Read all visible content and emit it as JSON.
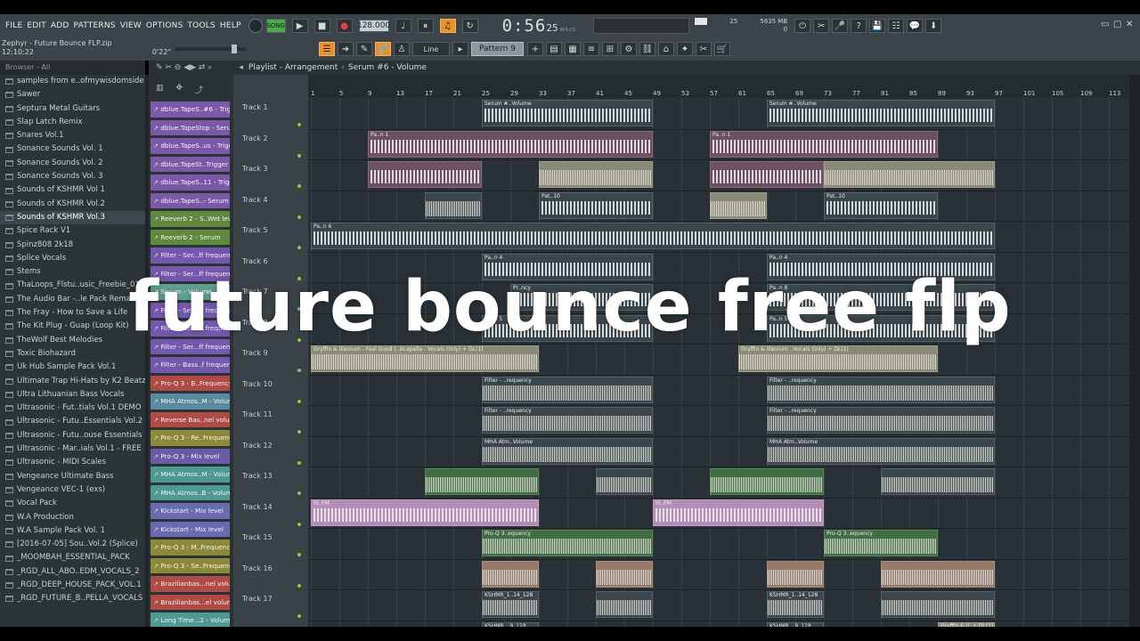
{
  "menu": [
    "FILE",
    "EDIT",
    "ADD",
    "PATTERNS",
    "VIEW",
    "OPTIONS",
    "TOOLS",
    "HELP"
  ],
  "transport": {
    "mode": "SONG",
    "tempo": "128.000",
    "time": "0:56",
    "time_frac": "25",
    "time_unit": "M:S:CS",
    "cpu": "25",
    "memory": "5635 MB",
    "memory_value": "0"
  },
  "project": {
    "file": "Zephyr - Future Bounce FLP.zip",
    "clock": "12:10:22",
    "position": "0'22\""
  },
  "toolbar": {
    "snap": "Line",
    "pattern": "Pattern 9"
  },
  "browser": {
    "header": "Browser - All",
    "selected_index": 10,
    "items": [
      "samples from e..ofmywisdomside",
      "Sawer",
      "Septura Metal Guitars",
      "Slap Latch Remix",
      "Snares Vol.1",
      "Sonance Sounds Vol. 1",
      "Sonance Sounds Vol. 2",
      "Sonance Sounds Vol. 3",
      "Sounds of KSHMR Vol 1",
      "Sounds of KSHMR Vol.2",
      "Sounds of KSHMR Vol.3",
      "Spice Rack V1",
      "Spinz808 2k18",
      "Splice Vocals",
      "Stems",
      "ThaLoops_Flstu..usic_Freebie_01",
      "The Audio Bar -..le Pack Remake)",
      "The Fray - How to Save a Life",
      "The Kit Plug - Guap (Loop Kit)",
      "TheWolf Best Melodies",
      "Toxic Biohazard",
      "Uk Hub Sample Pack Vol.1",
      "Ultimate Trap Hi-Hats by K2 Beatz",
      "Ultra Lithuanian Bass Vocals",
      "Ultrasonic - Fut..tials Vol.1 DEMO",
      "Ultrasonic - Futu..Essentials Vol.2",
      "Ultrasonic - Futu..ouse Essentials",
      "Ultrasonic - Mar..ials Vol.1 - FREE",
      "Ultrasonic - MIDI Scales",
      "Vengeance Ultimate Bass",
      "Vengeance VEC-1 (exs)",
      "Vocal Pack",
      "W.A Production",
      "W.A Sample Pack Vol. 1",
      "[2016-07-05] Sou..Vol.2 (Splice)",
      "_MOOMBAH_ESSENTIAL_PACK",
      "_RGD_ALL_ABO..EDM_VOCALS_2",
      "_RGD_DEEP_HOUSE_PACK_VOL.1",
      "_RGD_FUTURE_B..PELLA_VOCALS"
    ]
  },
  "clips": [
    {
      "label": "dblue.TapeS..#6 - Trigger",
      "color": "#7a5aa8"
    },
    {
      "label": "dblue.TapeStop - Serum",
      "color": "#7a5aa8"
    },
    {
      "label": "dblue.TapeS..us - Trigger",
      "color": "#7a5aa8"
    },
    {
      "label": "dblue.TapeSt..Trigger #2",
      "color": "#7a5aa8"
    },
    {
      "label": "dblue.TapeS..11 - Trigger",
      "color": "#7a5aa8"
    },
    {
      "label": "dblue.TapeS..- Serum #2",
      "color": "#7a5aa8"
    },
    {
      "label": "Reeverb 2 - S..Wet level",
      "color": "#5f8a3e"
    },
    {
      "label": "Reeverb 2 - Serum",
      "color": "#5f8a3e"
    },
    {
      "label": "Filter - Ser...ff frequency",
      "color": "#7458ad"
    },
    {
      "label": "Filter - Ser...ff frequency",
      "color": "#7458ad"
    },
    {
      "label": "Serum - Volume",
      "color": "#5fa090"
    },
    {
      "label": "Filter - Ser...ff frequency",
      "color": "#7458ad"
    },
    {
      "label": "Filter - Ser...ff frequency",
      "color": "#7458ad"
    },
    {
      "label": "Filter - Ser...ff frequency",
      "color": "#7458ad"
    },
    {
      "label": "Filter - Bass..f frequency",
      "color": "#7458ad"
    },
    {
      "label": "Pro-Q 3 - B..Frequency",
      "color": "#b04a44"
    },
    {
      "label": "MHA Atmos..M - Volume",
      "color": "#5a8aa0"
    },
    {
      "label": "Reverse Bas..nel volume",
      "color": "#b04a44"
    },
    {
      "label": "Pro-Q 3 - Re..Frequency",
      "color": "#8a8a3a"
    },
    {
      "label": "Pro-Q 3 - Mix level",
      "color": "#6a5aa8"
    },
    {
      "label": "MHA Atmos..M - Volume",
      "color": "#4f9a90"
    },
    {
      "label": "MHA Atmos..B - Volume",
      "color": "#4f9a90"
    },
    {
      "label": "Kickstart - Mix level",
      "color": "#6a6ab0"
    },
    {
      "label": "Kickstart - Mix level",
      "color": "#6a6ab0"
    },
    {
      "label": "Pro-Q 3 - M..Frequency",
      "color": "#8a8a3a"
    },
    {
      "label": "Pro-Q 3 - Se..Frequency",
      "color": "#8a8a3a"
    },
    {
      "label": "Brazilianbas...nel volume",
      "color": "#b04a44"
    },
    {
      "label": "Brazilianbas...el volume",
      "color": "#b04a44"
    },
    {
      "label": "Long Time...2 - Volume",
      "color": "#4f9a90"
    }
  ],
  "playlist": {
    "title": "Playlist - Arrangement",
    "breadcrumb": "Serum #6 - Volume",
    "ruler": [
      "1",
      "5",
      "9",
      "13",
      "17",
      "21",
      "25",
      "29",
      "33",
      "37",
      "41",
      "45",
      "49",
      "53",
      "57",
      "61",
      "65",
      "69",
      "73",
      "77",
      "81",
      "85",
      "89",
      "93",
      "97",
      "101",
      "105",
      "109",
      "113"
    ],
    "tracks": [
      "Track 1",
      "Track 2",
      "Track 3",
      "Track 4",
      "Track 5",
      "Track 6",
      "Track 7",
      "Track 8",
      "Track 9",
      "Track 10",
      "Track 11",
      "Track 12",
      "Track 13",
      "Track 14",
      "Track 15",
      "Track 16",
      "Track 17",
      "Track 18"
    ],
    "patterns": [
      {
        "track": 0,
        "start": 25,
        "end": 49,
        "label": "Serum #..Volume",
        "color": "c-dark",
        "style": "notes"
      },
      {
        "track": 0,
        "start": 65,
        "end": 97,
        "label": "Serum #..Volume",
        "color": "c-dark",
        "style": "notes"
      },
      {
        "track": 1,
        "start": 9,
        "end": 49,
        "label": "Pa..n 1",
        "color": "c-mauve",
        "style": "notes"
      },
      {
        "track": 1,
        "start": 57,
        "end": 89,
        "label": "Pa..n 1",
        "color": "c-mauve",
        "style": "notes"
      },
      {
        "track": 2,
        "start": 9,
        "end": 25,
        "label": "",
        "color": "c-mauve",
        "style": "notes"
      },
      {
        "track": 2,
        "start": 33,
        "end": 49,
        "label": "",
        "color": "c-tan",
        "style": "wave"
      },
      {
        "track": 2,
        "start": 57,
        "end": 73,
        "label": "",
        "color": "c-mauve",
        "style": "notes"
      },
      {
        "track": 2,
        "start": 73,
        "end": 97,
        "label": "",
        "color": "c-tan",
        "style": "wave"
      },
      {
        "track": 3,
        "start": 17,
        "end": 25,
        "label": "",
        "color": "c-dark",
        "style": "wave"
      },
      {
        "track": 3,
        "start": 33,
        "end": 49,
        "label": "Pat..10",
        "color": "c-dark",
        "style": "notes"
      },
      {
        "track": 3,
        "start": 57,
        "end": 65,
        "label": "",
        "color": "c-tan",
        "style": "wave"
      },
      {
        "track": 3,
        "start": 73,
        "end": 89,
        "label": "Pat..10",
        "color": "c-dark",
        "style": "notes"
      },
      {
        "track": 4,
        "start": 1,
        "end": 97,
        "label": "Pa..n 6",
        "color": "c-dark",
        "style": "notes"
      },
      {
        "track": 5,
        "start": 25,
        "end": 49,
        "label": "Pa..n 4",
        "color": "c-dark",
        "style": "notes"
      },
      {
        "track": 5,
        "start": 65,
        "end": 97,
        "label": "Pa..n 4",
        "color": "c-dark",
        "style": "notes"
      },
      {
        "track": 6,
        "start": 29,
        "end": 49,
        "label": "Pr..ncy",
        "color": "c-dark",
        "style": "notes"
      },
      {
        "track": 6,
        "start": 65,
        "end": 97,
        "label": "Pa..n 8",
        "color": "c-dark",
        "style": "notes"
      },
      {
        "track": 7,
        "start": 25,
        "end": 49,
        "label": "Pa..n 5",
        "color": "c-dark",
        "style": "notes"
      },
      {
        "track": 7,
        "start": 65,
        "end": 97,
        "label": "Pa..n 5",
        "color": "c-dark",
        "style": "notes"
      },
      {
        "track": 8,
        "start": 1,
        "end": 33,
        "label": "Gryffin & Illenium - Feel Good (..Acapella - Vocals Only) + DL(1)",
        "color": "c-tan",
        "style": "wave"
      },
      {
        "track": 8,
        "start": 61,
        "end": 89,
        "label": "Gryffin & Illenium ..Vocals Only) + DL(1)",
        "color": "c-tan",
        "style": "wave"
      },
      {
        "track": 9,
        "start": 25,
        "end": 49,
        "label": "Filter - ..requency",
        "color": "c-dark",
        "style": "wave"
      },
      {
        "track": 9,
        "start": 65,
        "end": 97,
        "label": "Filter - ..requency",
        "color": "c-dark",
        "style": "wave"
      },
      {
        "track": 10,
        "start": 25,
        "end": 49,
        "label": "Filter - ..requency",
        "color": "c-dark",
        "style": "wave"
      },
      {
        "track": 10,
        "start": 65,
        "end": 97,
        "label": "Filter - ..requency",
        "color": "c-dark",
        "style": "wave"
      },
      {
        "track": 11,
        "start": 25,
        "end": 49,
        "label": "MHA Atm..Volume",
        "color": "c-dark",
        "style": "wave"
      },
      {
        "track": 11,
        "start": 65,
        "end": 97,
        "label": "MHA Atm..Volume",
        "color": "c-dark",
        "style": "wave"
      },
      {
        "track": 12,
        "start": 17,
        "end": 33,
        "label": "",
        "color": "c-green",
        "style": "wave"
      },
      {
        "track": 12,
        "start": 41,
        "end": 49,
        "label": "",
        "color": "c-dark",
        "style": "wave"
      },
      {
        "track": 12,
        "start": 57,
        "end": 73,
        "label": "",
        "color": "c-green",
        "style": "wave"
      },
      {
        "track": 12,
        "start": 81,
        "end": 97,
        "label": "",
        "color": "c-dark",
        "style": "wave"
      },
      {
        "track": 13,
        "start": 1,
        "end": 33,
        "label": "M..PM",
        "color": "c-pink",
        "style": "notes"
      },
      {
        "track": 13,
        "start": 49,
        "end": 73,
        "label": "M..PM",
        "color": "c-pink",
        "style": "notes"
      },
      {
        "track": 14,
        "start": 25,
        "end": 49,
        "label": "Pro-Q 3..equency",
        "color": "c-green",
        "style": "wave"
      },
      {
        "track": 14,
        "start": 73,
        "end": 89,
        "label": "Pro-Q 3..equency",
        "color": "c-green",
        "style": "wave"
      },
      {
        "track": 15,
        "start": 25,
        "end": 33,
        "label": "",
        "color": "c-peach",
        "style": "wave"
      },
      {
        "track": 15,
        "start": 41,
        "end": 49,
        "label": "",
        "color": "c-peach",
        "style": "wave"
      },
      {
        "track": 15,
        "start": 65,
        "end": 73,
        "label": "",
        "color": "c-peach",
        "style": "wave"
      },
      {
        "track": 15,
        "start": 81,
        "end": 97,
        "label": "",
        "color": "c-peach",
        "style": "wave"
      },
      {
        "track": 16,
        "start": 25,
        "end": 33,
        "label": "KSHMR_1..14_128",
        "color": "c-dark",
        "style": "wave"
      },
      {
        "track": 16,
        "start": 41,
        "end": 49,
        "label": "",
        "color": "c-dark",
        "style": "wave"
      },
      {
        "track": 16,
        "start": 65,
        "end": 73,
        "label": "KSHMR_1..14_128",
        "color": "c-dark",
        "style": "wave"
      },
      {
        "track": 16,
        "start": 81,
        "end": 97,
        "label": "",
        "color": "c-dark",
        "style": "wave"
      },
      {
        "track": 17,
        "start": 25,
        "end": 33,
        "label": "KSHMR_..9_128",
        "color": "c-dark",
        "style": "wave"
      },
      {
        "track": 17,
        "start": 65,
        "end": 73,
        "label": "KSHMR_..9_128",
        "color": "c-dark",
        "style": "wave"
      },
      {
        "track": 17,
        "start": 89,
        "end": 97,
        "label": "Gryffin & Il..+ DL(1)",
        "color": "c-tan",
        "style": "wave"
      }
    ]
  },
  "overlay_text": "future bounce free flp",
  "colors": {
    "accent": "#e8922c",
    "background": "#293136",
    "song_mode": "#4aa84d"
  }
}
